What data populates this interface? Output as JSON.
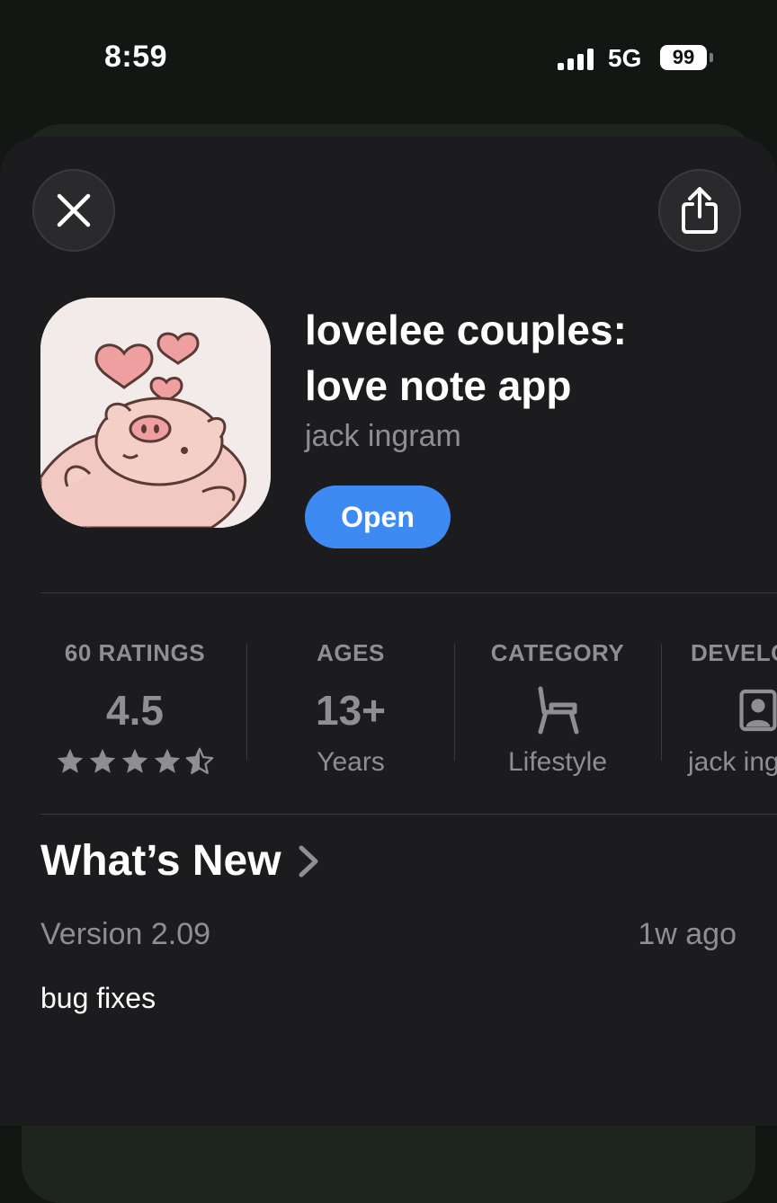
{
  "status_bar": {
    "time": "8:59",
    "network": "5G",
    "battery": "99"
  },
  "header": {
    "close_icon": "close-icon",
    "share_icon": "share-icon"
  },
  "app": {
    "title_line1": "lovelee couples:",
    "title_line2": "love note app",
    "developer": "jack ingram",
    "open_label": "Open",
    "accent_color": "#3d8bf2"
  },
  "info": {
    "ratings": {
      "label": "60 RATINGS",
      "value": "4.5",
      "stars": 4.5
    },
    "ages": {
      "label": "AGES",
      "value": "13+",
      "sub": "Years"
    },
    "category": {
      "label": "CATEGORY",
      "icon": "chair-icon",
      "sub": "Lifestyle"
    },
    "developer": {
      "label": "DEVELOPER",
      "icon": "person-icon",
      "sub": "jack ingram"
    }
  },
  "whats_new": {
    "title": "What’s New",
    "version": "Version 2.09",
    "time_ago": "1w ago",
    "notes": "bug fixes"
  }
}
